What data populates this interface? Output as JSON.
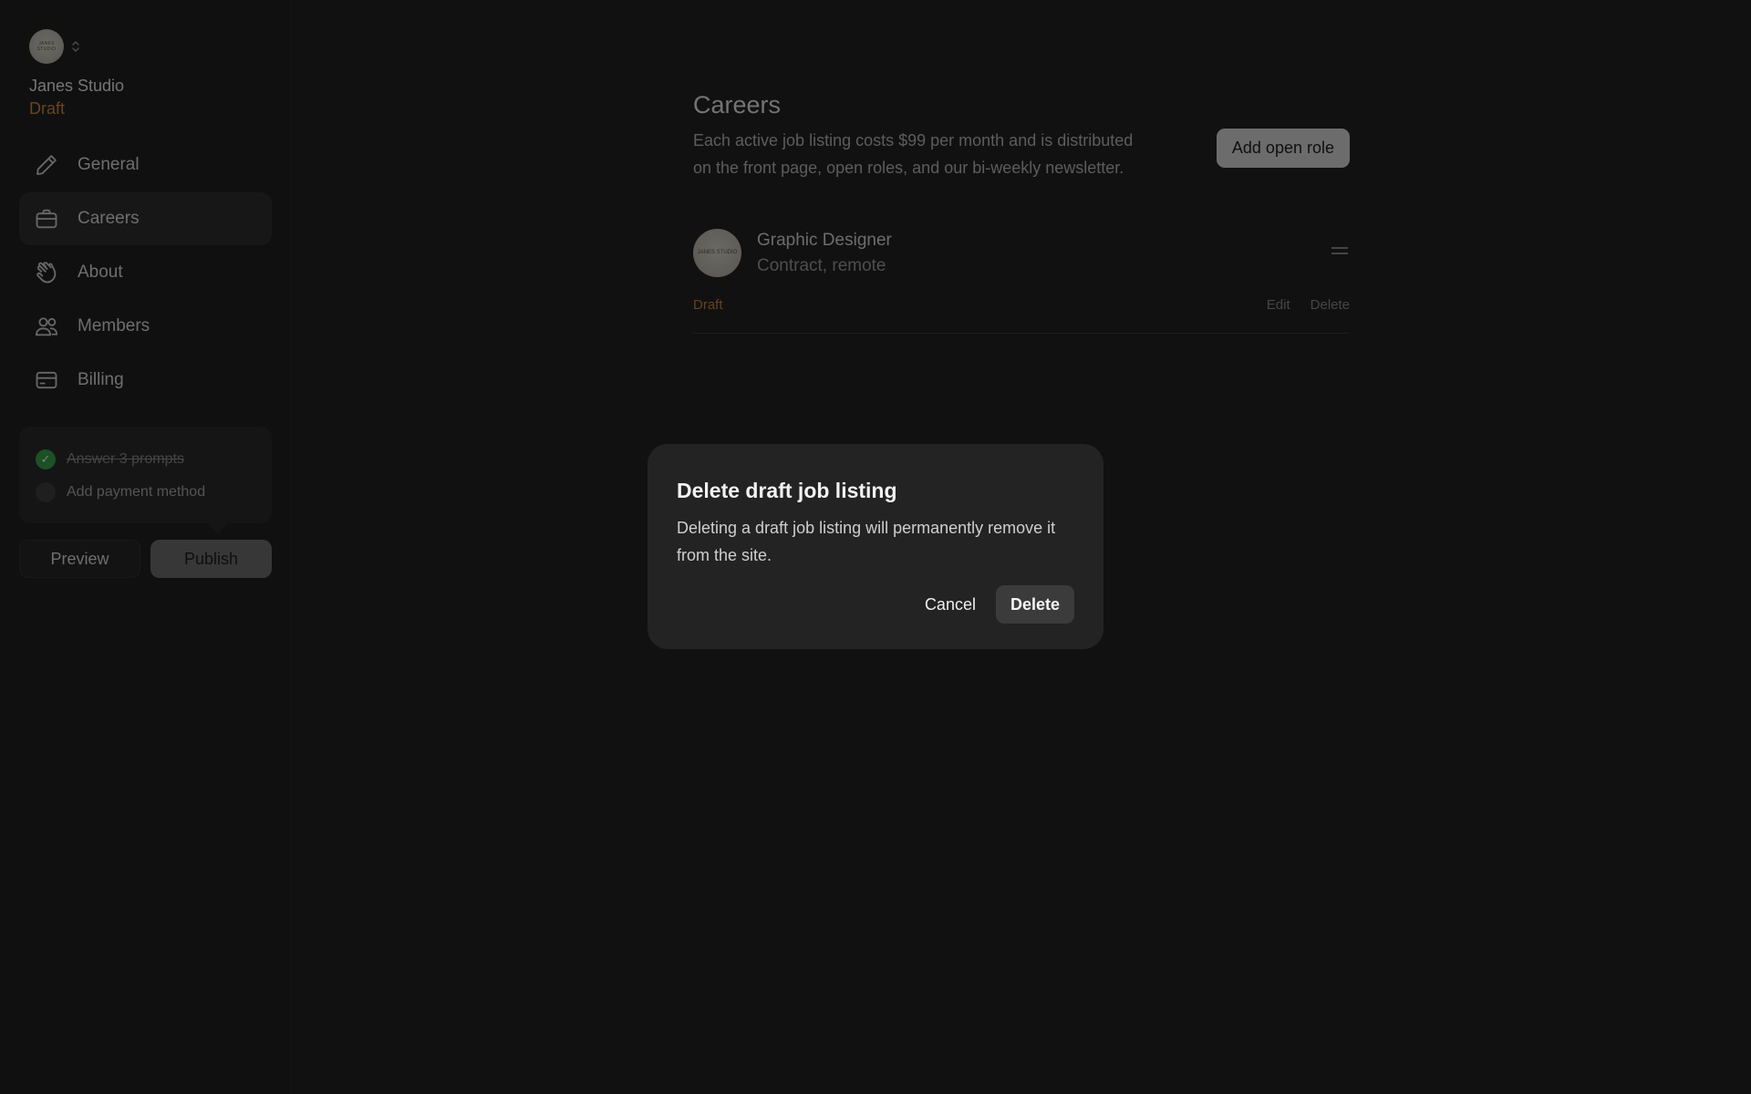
{
  "workspace": {
    "avatar_text": "JANES STUDIO",
    "name": "Janes Studio",
    "status": "Draft"
  },
  "sidebar": {
    "items": [
      {
        "label": "General",
        "icon": "pencil-icon"
      },
      {
        "label": "Careers",
        "icon": "briefcase-icon",
        "active": true
      },
      {
        "label": "About",
        "icon": "waving-hand-icon"
      },
      {
        "label": "Members",
        "icon": "users-icon"
      },
      {
        "label": "Billing",
        "icon": "credit-card-icon"
      }
    ],
    "checklist": [
      {
        "label": "Answer 3 prompts",
        "done": true
      },
      {
        "label": "Add payment method",
        "done": false
      }
    ],
    "preview_label": "Preview",
    "publish_label": "Publish"
  },
  "main": {
    "title": "Careers",
    "description": "Each active job listing costs $99 per month and is distributed on the front page, open roles, and our bi-weekly newsletter.",
    "add_role_label": "Add open role",
    "listing": {
      "avatar_text": "JANES STUDIO",
      "title": "Graphic Designer",
      "subtitle": "Contract, remote",
      "status": "Draft",
      "edit_label": "Edit",
      "delete_label": "Delete"
    }
  },
  "modal": {
    "title": "Delete draft job listing",
    "body": "Deleting a draft job listing will permanently remove it from the site.",
    "cancel_label": "Cancel",
    "delete_label": "Delete"
  },
  "colors": {
    "accent_draft": "#d08a3c",
    "check_done": "#37a24b",
    "background": "#222222"
  }
}
